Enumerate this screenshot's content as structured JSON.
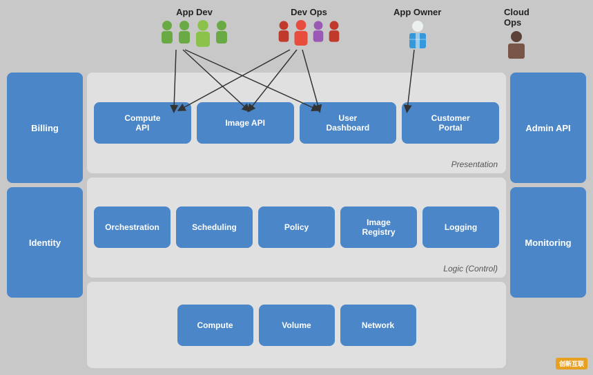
{
  "personas": [
    {
      "id": "app-dev",
      "label": "App Dev",
      "color": "green",
      "count": 4,
      "leftPercent": 22
    },
    {
      "id": "dev-ops",
      "label": "Dev Ops",
      "color": "red",
      "count": 4,
      "leftPercent": 47
    },
    {
      "id": "app-owner",
      "label": "App Owner",
      "color": "blue",
      "count": 1,
      "leftPercent": 68
    },
    {
      "id": "cloud-ops",
      "label": "Cloud Ops",
      "color": "brown",
      "count": 1,
      "leftPercent": 88
    }
  ],
  "left_col": [
    {
      "id": "billing",
      "label": "Billing"
    },
    {
      "id": "identity",
      "label": "Identity"
    }
  ],
  "right_col": [
    {
      "id": "admin-api",
      "label": "Admin API"
    },
    {
      "id": "monitoring",
      "label": "Monitoring"
    }
  ],
  "presentation_boxes": [
    {
      "id": "compute-api",
      "label": "Compute\nAPI"
    },
    {
      "id": "image-api",
      "label": "Image API"
    },
    {
      "id": "user-dashboard",
      "label": "User\nDashboard"
    },
    {
      "id": "customer-portal",
      "label": "Customer\nPortal"
    }
  ],
  "presentation_label": "Presentation",
  "logic_boxes": [
    {
      "id": "orchestration",
      "label": "Orchestration"
    },
    {
      "id": "scheduling",
      "label": "Scheduling"
    },
    {
      "id": "policy",
      "label": "Policy"
    },
    {
      "id": "image-registry",
      "label": "Image\nRegistry"
    },
    {
      "id": "logging",
      "label": "Logging"
    }
  ],
  "logic_label": "Logic (Control)",
  "resource_boxes": [
    {
      "id": "compute",
      "label": "Compute"
    },
    {
      "id": "volume",
      "label": "Volume"
    },
    {
      "id": "network",
      "label": "Network"
    }
  ],
  "watermark": "创新互联"
}
